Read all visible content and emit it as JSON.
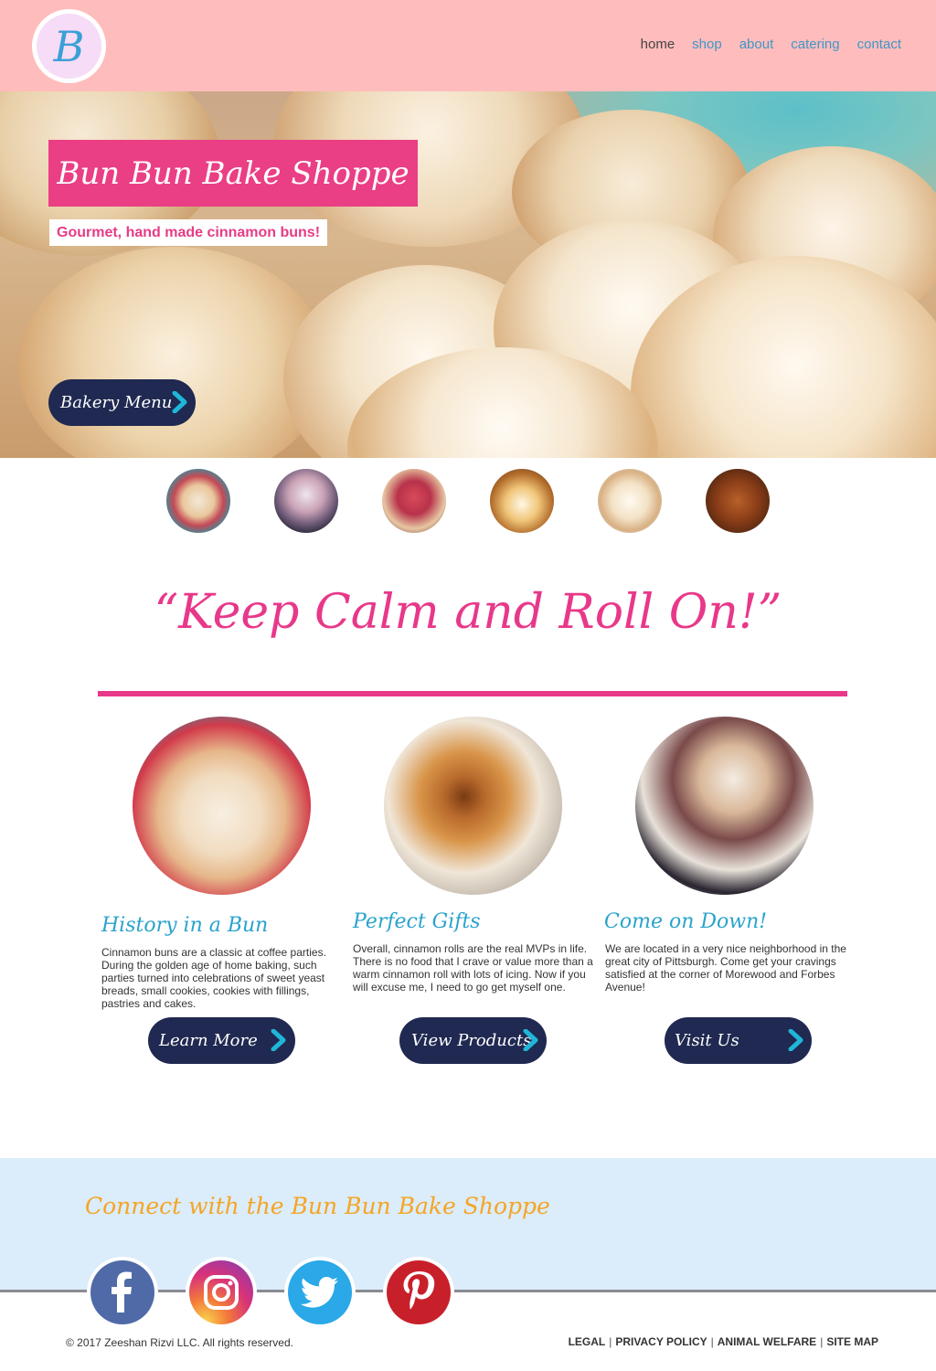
{
  "header": {
    "logo_letter": "B",
    "nav": [
      "home",
      "shop",
      "about",
      "catering",
      "contact"
    ]
  },
  "hero": {
    "title": "Bun Bun Bake Shoppe",
    "subtitle": "Gourmet, hand made cinnamon buns!",
    "button": "Bakery Menu"
  },
  "tagline": "“Keep Calm and Roll On!”",
  "features": [
    {
      "title": "History in a Bun",
      "text": "Cinnamon buns are a classic at coffee parties. During the golden age of home baking, such parties turned into celebrations of sweet yeast breads, small cookies, cookies with fillings, pastries and cakes.",
      "button": "Learn More"
    },
    {
      "title": "Perfect Gifts",
      "text": "Overall, cinnamon rolls are the real MVPs in life. There is no food that I crave or value more than a warm cinnamon roll with lots of icing. Now if you will excuse me, I need to go get myself one.",
      "button": "View Products"
    },
    {
      "title": "Come on Down!",
      "text": "We are located in a very nice neighborhood in the great city of Pittsburgh. Come get your cravings satisfied at the corner of Morewood and Forbes Avenue!",
      "button": "Visit Us"
    }
  ],
  "footer": {
    "connect_title": "Connect with the Bun Bun Bake Shoppe",
    "copyright": "© 2017 Zeeshan Rizvi LLC. All rights reserved.",
    "links": [
      "LEGAL",
      "PRIVACY POLICY",
      "ANIMAL WELFARE",
      "SITE MAP"
    ],
    "link_separator": "|"
  },
  "icons": {
    "logo": "b-monogram-icon",
    "button_arrow": "chevron-right-icon",
    "social": [
      "facebook-icon",
      "instagram-icon",
      "twitter-icon",
      "pinterest-icon"
    ]
  },
  "colors": {
    "header_bg": "#ffbcbc",
    "accent_pink": "#e8388a",
    "nav_blue": "#3e97c6",
    "button_navy": "#1f2951",
    "chevron_cyan": "#1fb6d8",
    "footer_bg": "#dbecfa",
    "connect_orange": "#f5a524"
  }
}
